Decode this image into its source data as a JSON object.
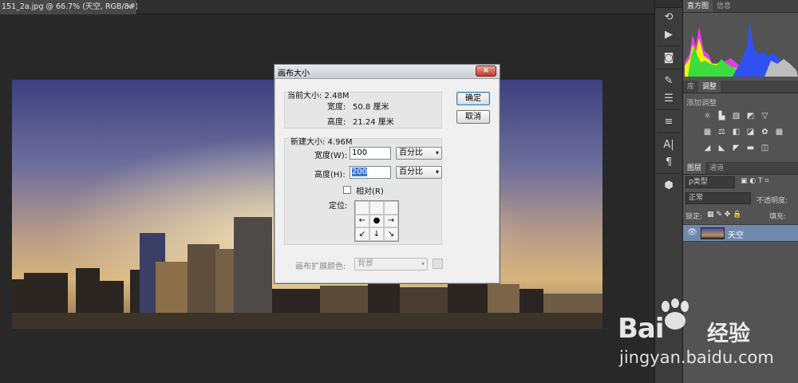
{
  "document_tab": {
    "title": "151_2a.jpg @ 66.7% (天空, RGB/8#) *",
    "close": "×"
  },
  "toolstrip": {
    "tools": [
      "history-icon",
      "play-icon",
      "info-icon",
      "brush-icon",
      "sliders-icon",
      "character-icon",
      "paragraph-icon",
      "cube-icon"
    ],
    "labels": {
      "char": "A|",
      "para": "¶"
    }
  },
  "panels": {
    "top_tabs": [
      "直方图",
      "信息"
    ],
    "mid_tabs": [
      "库",
      "调整"
    ],
    "adjustments_title": "添加调整",
    "layer_tabs": [
      "图层",
      "通道"
    ],
    "filter_kind": "ρ类型",
    "blend_mode": "正常",
    "opacity_label": "不透明度:",
    "lock_label": "锁定:",
    "fill_label": "填充:",
    "layer_name": "天空",
    "histogram_colors": {
      "yellow": "#f5f500",
      "green": "#3fdc3f",
      "magenta": "#e040e0",
      "blue": "#3050f0",
      "gray": "#bdbdbd"
    }
  },
  "dialog": {
    "title": "画布大小",
    "close": "×",
    "current_size_label": "当前大小: 2.48M",
    "current_width_label": "宽度:",
    "current_width_value": "50.8 厘米",
    "current_height_label": "高度:",
    "current_height_value": "21.24 厘米",
    "new_size_label": "新建大小: 4.96M",
    "width_label": "宽度(W):",
    "width_value": "100",
    "width_unit": "百分比",
    "height_label": "高度(H):",
    "height_value": "200",
    "height_unit": "百分比",
    "relative_label": "相对(R)",
    "anchor_label": "定位:",
    "anchor_glyphs": [
      "↖",
      "↑",
      "↗",
      "←",
      "●",
      "→",
      "↙",
      "↓",
      "↘"
    ],
    "extension_color_label": "画布扩展颜色:",
    "extension_color_value": "背景",
    "ok_label": "确定",
    "cancel_label": "取消"
  },
  "watermark": {
    "brand": "Bai",
    "brand_cn": "经验",
    "url": "jingyan.baidu.com"
  }
}
